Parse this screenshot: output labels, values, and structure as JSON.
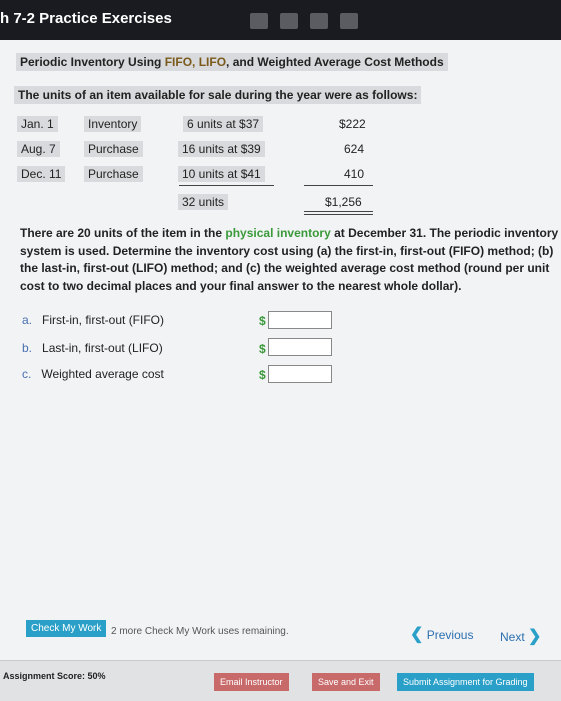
{
  "header": {
    "title": "h 7-2 Practice Exercises"
  },
  "problem": {
    "heading_pre": "Periodic Inventory Using ",
    "heading_mid": "FIFO, LIFO",
    "heading_post": ", and Weighted Average Cost Methods",
    "intro": "The units of an item available for sale during the year were as follows:",
    "rows": [
      {
        "date": "Jan. 1",
        "type": "Inventory",
        "units": "6 units at $37",
        "amount": "$222"
      },
      {
        "date": "Aug. 7",
        "type": "Purchase",
        "units": "16 units at $39",
        "amount": "624"
      },
      {
        "date": "Dec. 11",
        "type": "Purchase",
        "units": "10 units at $41",
        "amount": "410"
      }
    ],
    "total_units": "32 units",
    "total_amount": "$1,256",
    "p1": "There are 20 units of the item in the ",
    "p_link": "physical inventory",
    "p2": " at December 31. The periodic inventory system is used. Determine the inventory cost using (a) the first-in, first-out (FIFO) method; (b) the last-in, first-out (LIFO) method; and (c) the weighted average cost method (round per unit cost to two decimal places and your final answer to the nearest whole dollar).",
    "answers": [
      {
        "letter": "a.",
        "label": "First-in, first-out (FIFO)",
        "currency": "$",
        "value": ""
      },
      {
        "letter": "b.",
        "label": "Last-in, first-out (LIFO)",
        "currency": "$",
        "value": ""
      },
      {
        "letter": "c.",
        "label": "Weighted average cost",
        "currency": "$",
        "value": ""
      }
    ]
  },
  "check": {
    "label": "Check My Work",
    "remaining": "2 more Check My Work uses remaining."
  },
  "nav": {
    "previous": "Previous",
    "next": "Next"
  },
  "footer": {
    "score": "Assignment Score: 50%",
    "email": "Email Instructor",
    "save": "Save and Exit",
    "submit": "Submit Assignment for Grading"
  },
  "colors": {
    "link_green": "#3a9a3a",
    "accent_blue": "#2aa0c8"
  }
}
